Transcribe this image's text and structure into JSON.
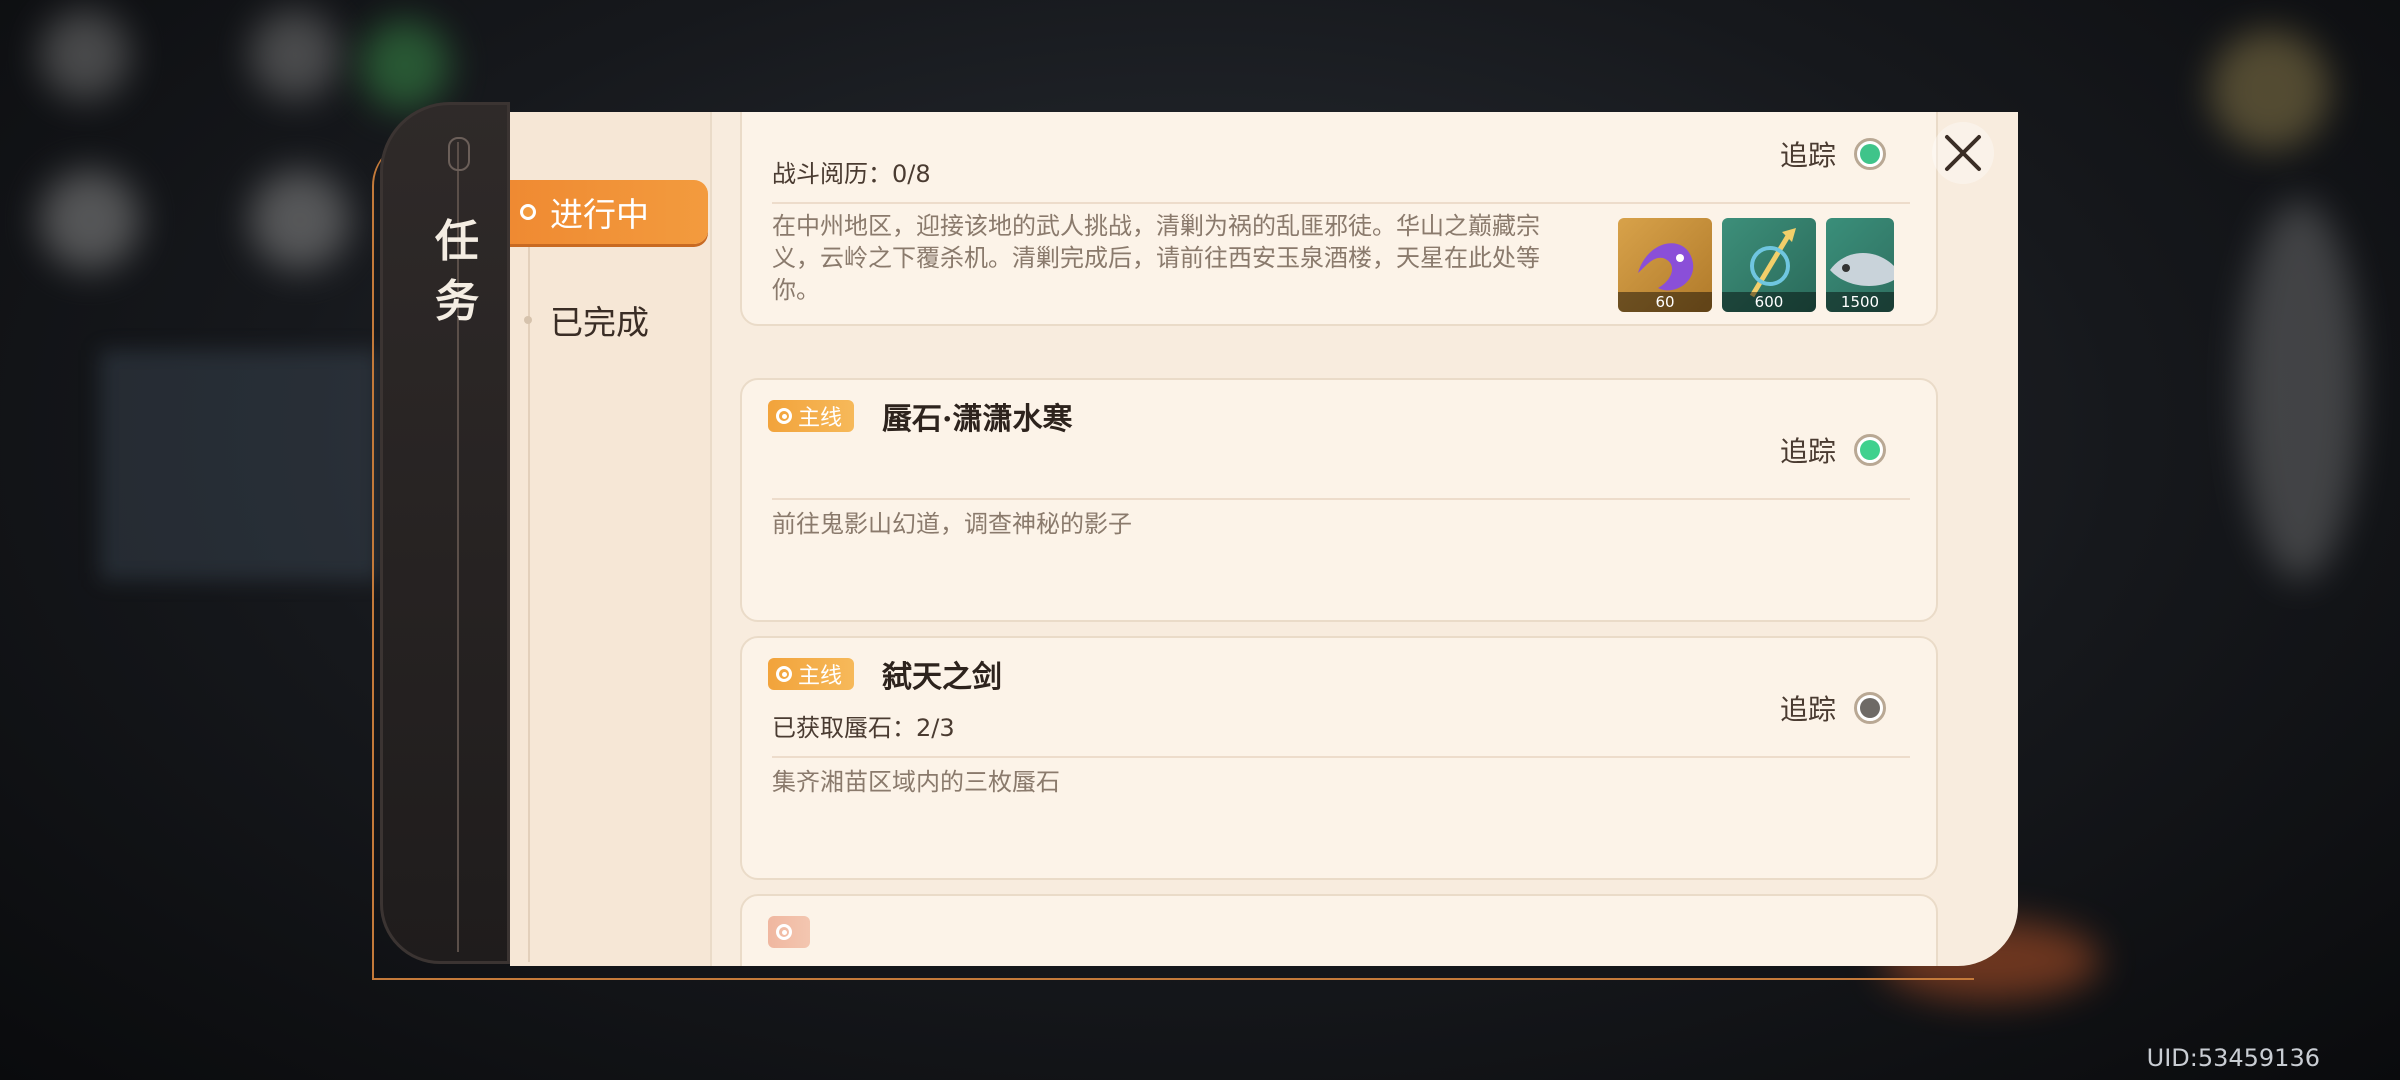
{
  "sidebar": {
    "title": "任务"
  },
  "tabs": [
    {
      "label": "进行中",
      "active": true
    },
    {
      "label": "已完成",
      "active": false
    }
  ],
  "quests": [
    {
      "badge": "",
      "title": "",
      "progress": "战斗阅历：0/8",
      "track_label": "追踪",
      "tracked_color": "#3fc48a",
      "description": "在中州地区，迎接该地的武人挑战，清剿为祸的乱匪邪徒。华山之巅藏宗义，云岭之下覆杀机。清剿完成后，请前往西安玉泉酒楼，天星在此处等你。",
      "rewards": [
        {
          "icon": "purple-fish-icon",
          "amount": "60"
        },
        {
          "icon": "trident-icon",
          "amount": "600"
        },
        {
          "icon": "silver-fish-icon",
          "amount": "1500"
        }
      ]
    },
    {
      "badge": "主线",
      "title": "蜃石·潇潇水寒",
      "progress": "",
      "track_label": "追踪",
      "tracked_color": "#3fd18e",
      "description": "前往鬼影山幻道，调查神秘的影子"
    },
    {
      "badge": "主线",
      "title": "弑天之剑",
      "progress": "已获取蜃石：2/3",
      "track_label": "追踪",
      "tracked_color": "#6e6a66",
      "description": "集齐湘苗区域内的三枚蜃石"
    },
    {
      "badge": "",
      "title": "",
      "progress": "",
      "track_label": "",
      "tracked_color": "",
      "description": ""
    }
  ],
  "uid": "UID:53459136",
  "colors": {
    "accent": "#ef8a32",
    "panel": "#f8ecde",
    "badge": "#f2a33b"
  }
}
